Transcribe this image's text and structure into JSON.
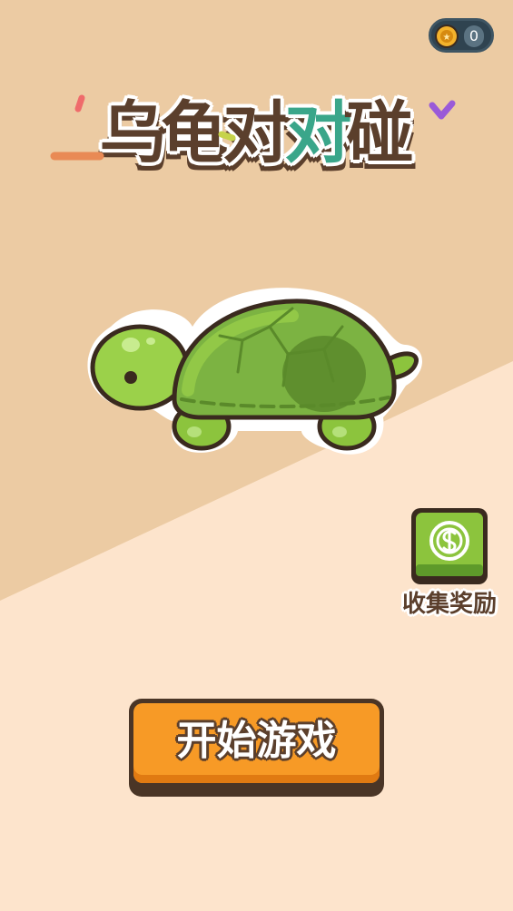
{
  "colors": {
    "bg_top": "#eccba3",
    "bg_bottom": "#fde4cc",
    "accent_orange": "#f79a26",
    "text_brown": "#5b3f2c",
    "turtle_green": "#7cb342"
  },
  "hud": {
    "coin_icon": "gold-coin-icon",
    "coin_count": "0"
  },
  "title": {
    "chars": [
      "乌",
      "龟",
      "对",
      "对",
      "碰"
    ]
  },
  "rewards": {
    "icon": "coin-icon",
    "label": "收集奖励"
  },
  "start_button": {
    "label": "开始游戏"
  },
  "mascot": {
    "icon": "turtle-icon"
  }
}
